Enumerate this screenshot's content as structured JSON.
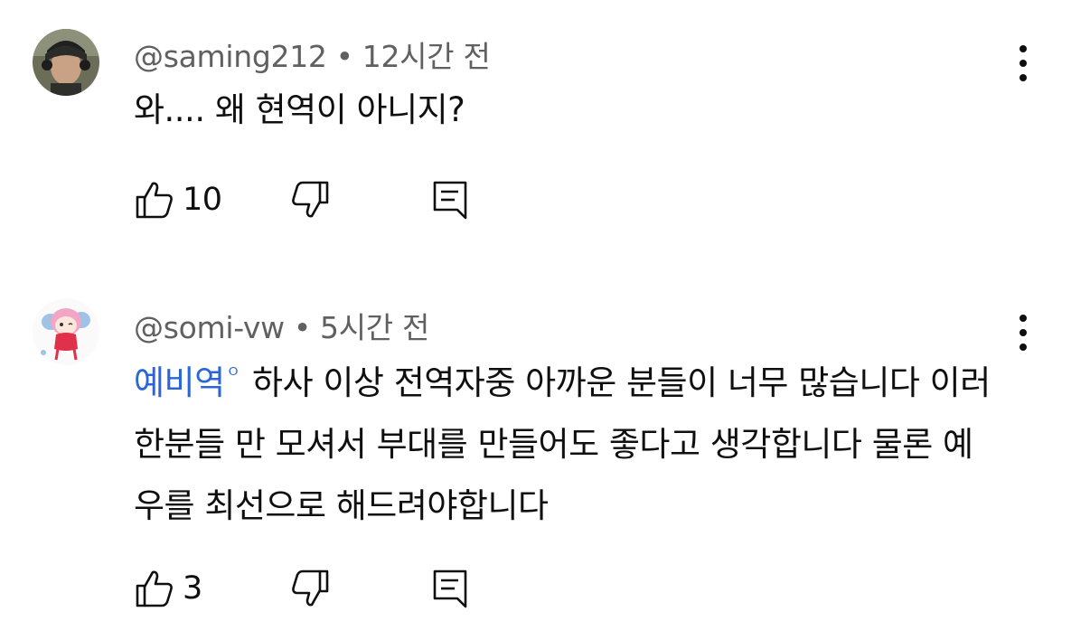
{
  "comments": [
    {
      "author": "@saming212",
      "separator": "•",
      "time": "12시간 전",
      "badge": "",
      "text": "와.... 왜 현역이 아니지?",
      "likes": "10",
      "avatar_icon": "user-photo-headset",
      "menu_icon": "more-vert-icon"
    },
    {
      "author": "@somi-vw",
      "separator": "•",
      "time": "5시간 전",
      "badge": "예비역",
      "badge_icon": "ᴼ",
      "text": "하사 이상 전역자중 아까운 분들이 너무 많습니다 이러한분들 만 모셔서 부대를 만들어도 좋다고 생각합니다 물론 예우를 최선으로 해드려야합니다",
      "likes": "3",
      "avatar_icon": "user-avatar-anime-pink-hair",
      "menu_icon": "more-vert-icon"
    }
  ],
  "colors": {
    "text": "#0f0f0f",
    "meta": "#606060",
    "badge": "#2a66d9"
  }
}
